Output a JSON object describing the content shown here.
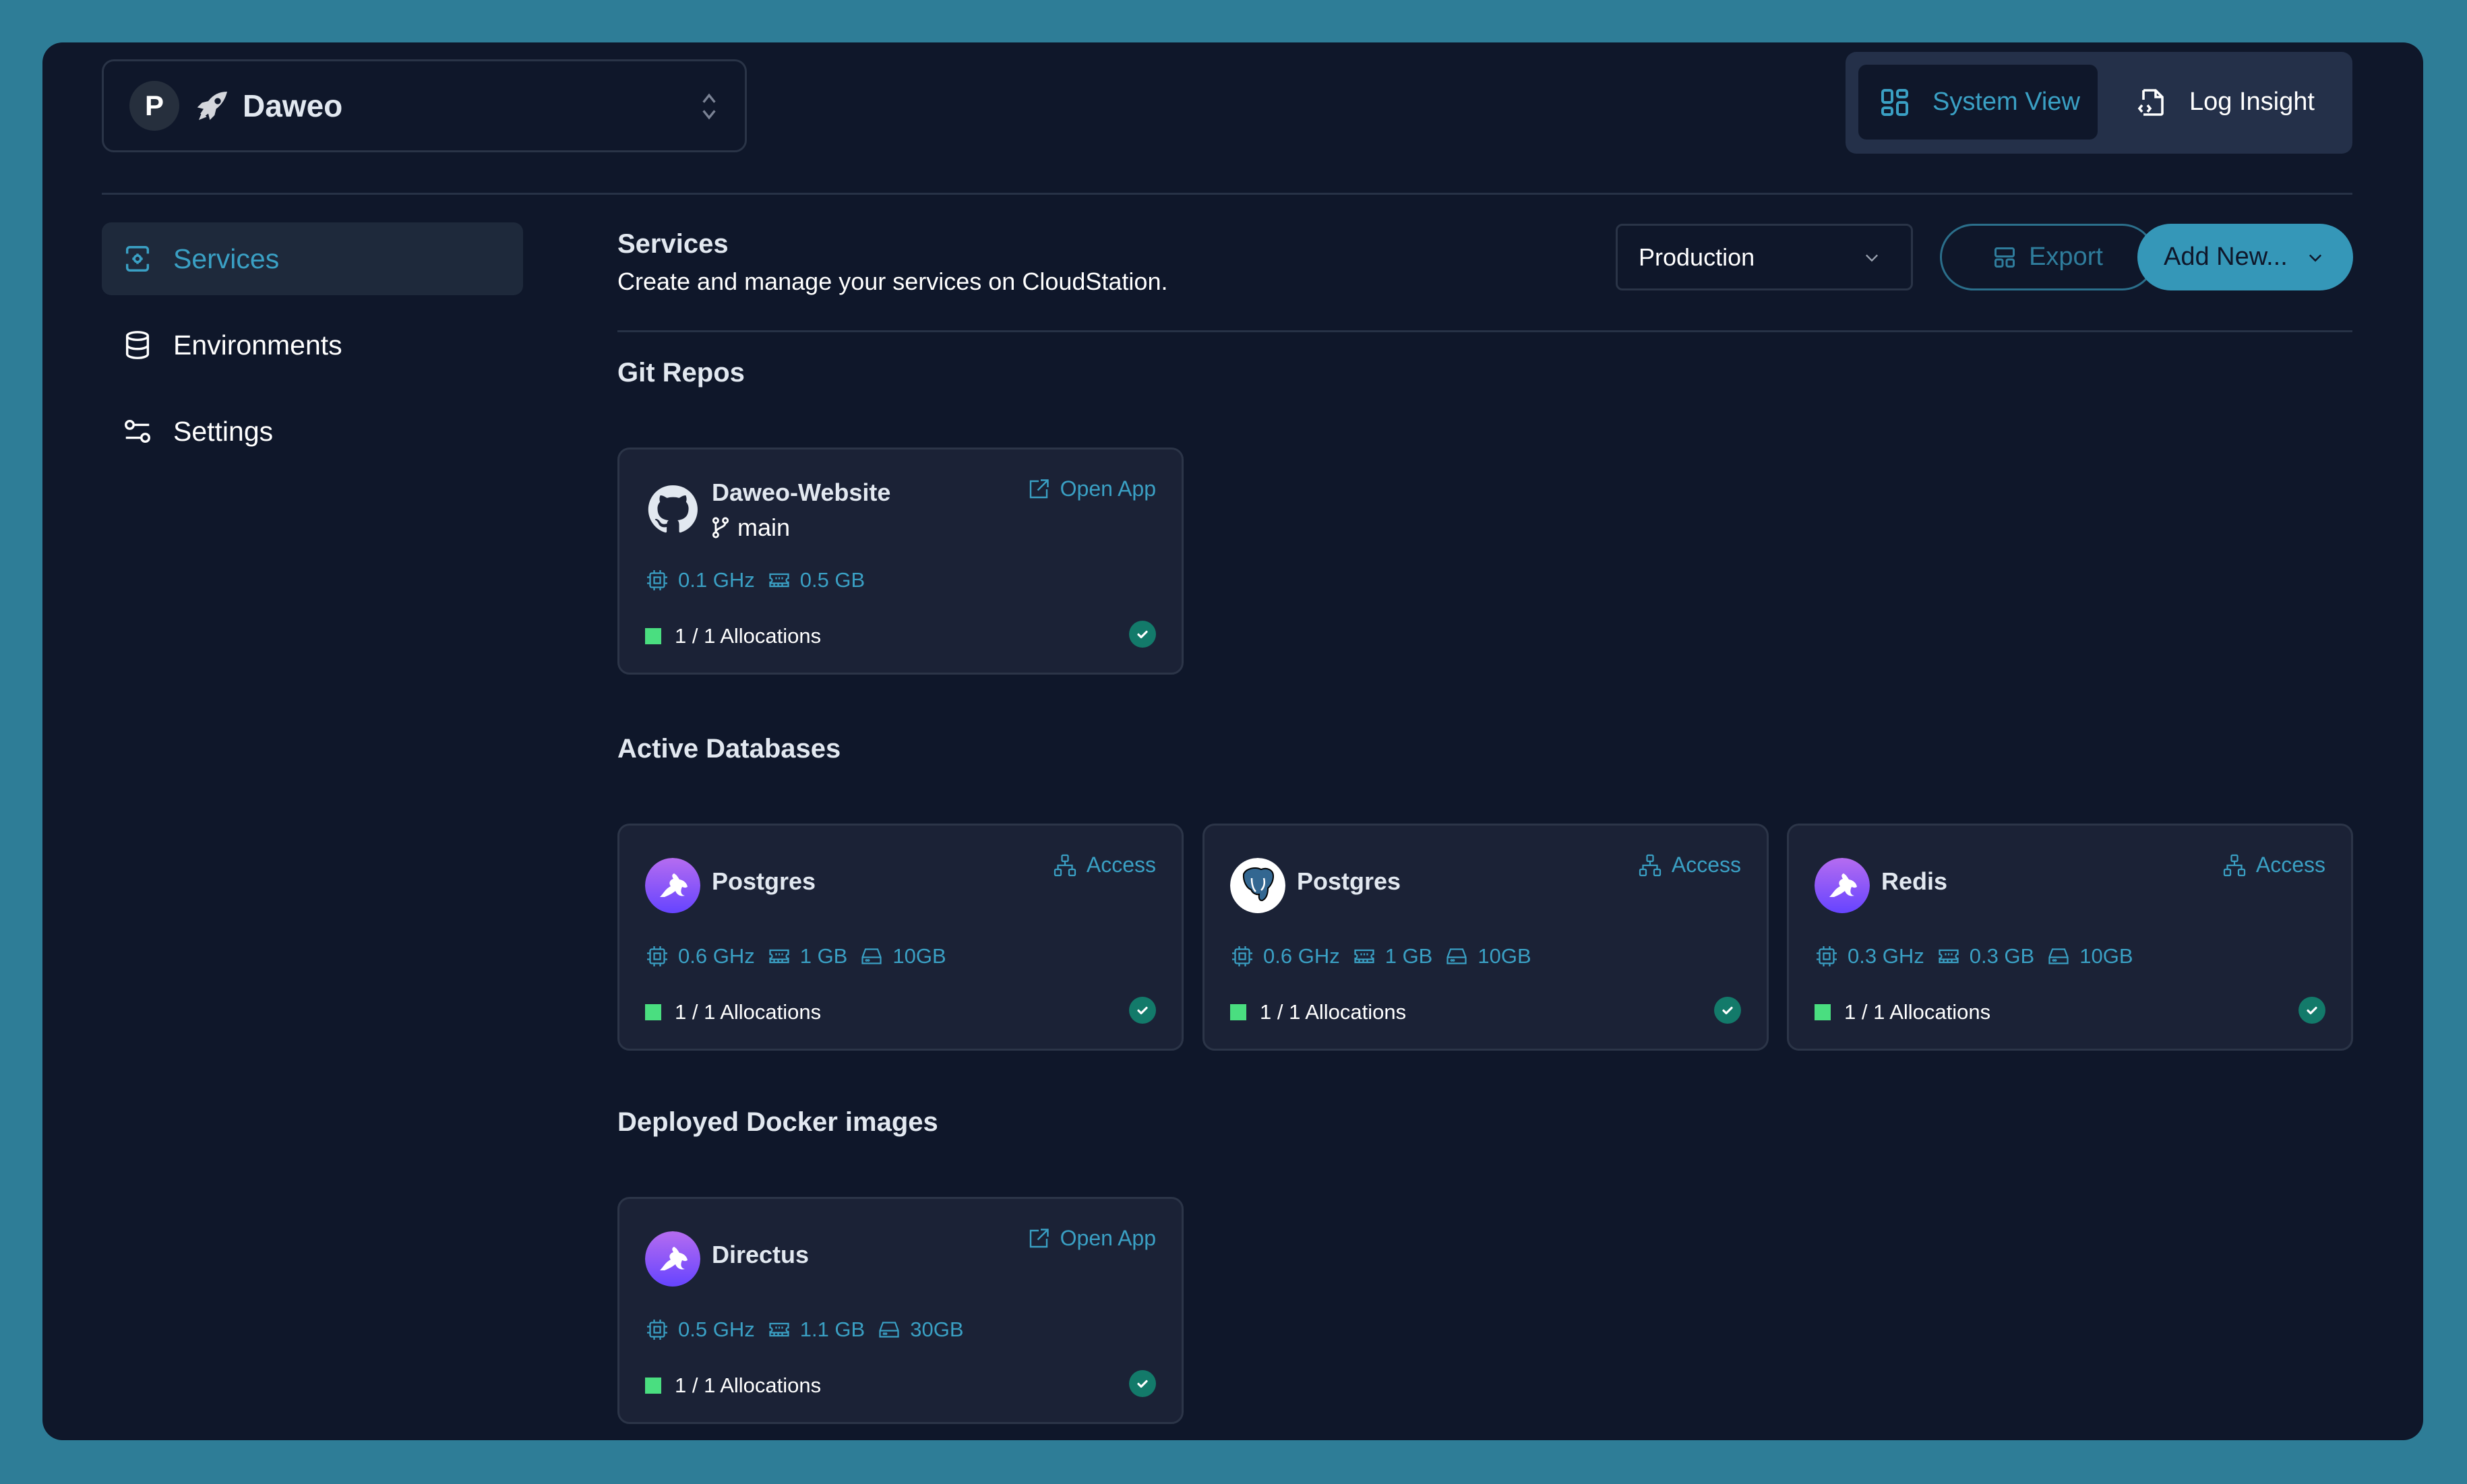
{
  "project": {
    "avatar_letter": "P",
    "name": "Daweo",
    "icon": "rocket-icon"
  },
  "view_toggle": {
    "items": [
      {
        "label": "System View",
        "icon": "grid-icon",
        "active": true
      },
      {
        "label": "Log Insight",
        "icon": "file-code-icon",
        "active": false
      }
    ]
  },
  "sidebar": {
    "items": [
      {
        "label": "Services",
        "icon": "services-icon",
        "active": true
      },
      {
        "label": "Environments",
        "icon": "database-icon",
        "active": false
      },
      {
        "label": "Settings",
        "icon": "sliders-icon",
        "active": false
      }
    ]
  },
  "header": {
    "title": "Services",
    "subtitle": "Create and manage your services on CloudStation.",
    "environment_select": "Production",
    "export_label": "Export",
    "add_new_label": "Add New..."
  },
  "colors": {
    "accent": "#3aa0c4",
    "button_primary": "#3597b8",
    "status_ok": "#137a6a",
    "allocation": "#4ade80",
    "background": "#0f172a",
    "outer": "#2e7d97"
  },
  "sections": {
    "git_repos": {
      "title": "Git Repos",
      "cards": [
        {
          "name": "Daweo-Website",
          "branch": "main",
          "logo": "github",
          "action": "Open App",
          "cpu": "0.1 GHz",
          "memory": "0.5 GB",
          "allocations": "1 / 1 Allocations",
          "status": "healthy"
        }
      ]
    },
    "databases": {
      "title": "Active Databases",
      "cards": [
        {
          "name": "Postgres",
          "logo": "directus",
          "action": "Access",
          "cpu": "0.6 GHz",
          "memory": "1 GB",
          "disk": "10GB",
          "allocations": "1 / 1 Allocations",
          "status": "healthy"
        },
        {
          "name": "Postgres",
          "logo": "postgres",
          "action": "Access",
          "cpu": "0.6 GHz",
          "memory": "1 GB",
          "disk": "10GB",
          "allocations": "1 / 1 Allocations",
          "status": "healthy"
        },
        {
          "name": "Redis",
          "logo": "directus",
          "action": "Access",
          "cpu": "0.3 GHz",
          "memory": "0.3 GB",
          "disk": "10GB",
          "allocations": "1 / 1 Allocations",
          "status": "healthy"
        }
      ]
    },
    "docker": {
      "title": "Deployed Docker images",
      "cards": [
        {
          "name": "Directus",
          "logo": "directus",
          "action": "Open App",
          "cpu": "0.5 GHz",
          "memory": "1.1 GB",
          "disk": "30GB",
          "allocations": "1 / 1 Allocations",
          "status": "healthy"
        }
      ]
    }
  }
}
